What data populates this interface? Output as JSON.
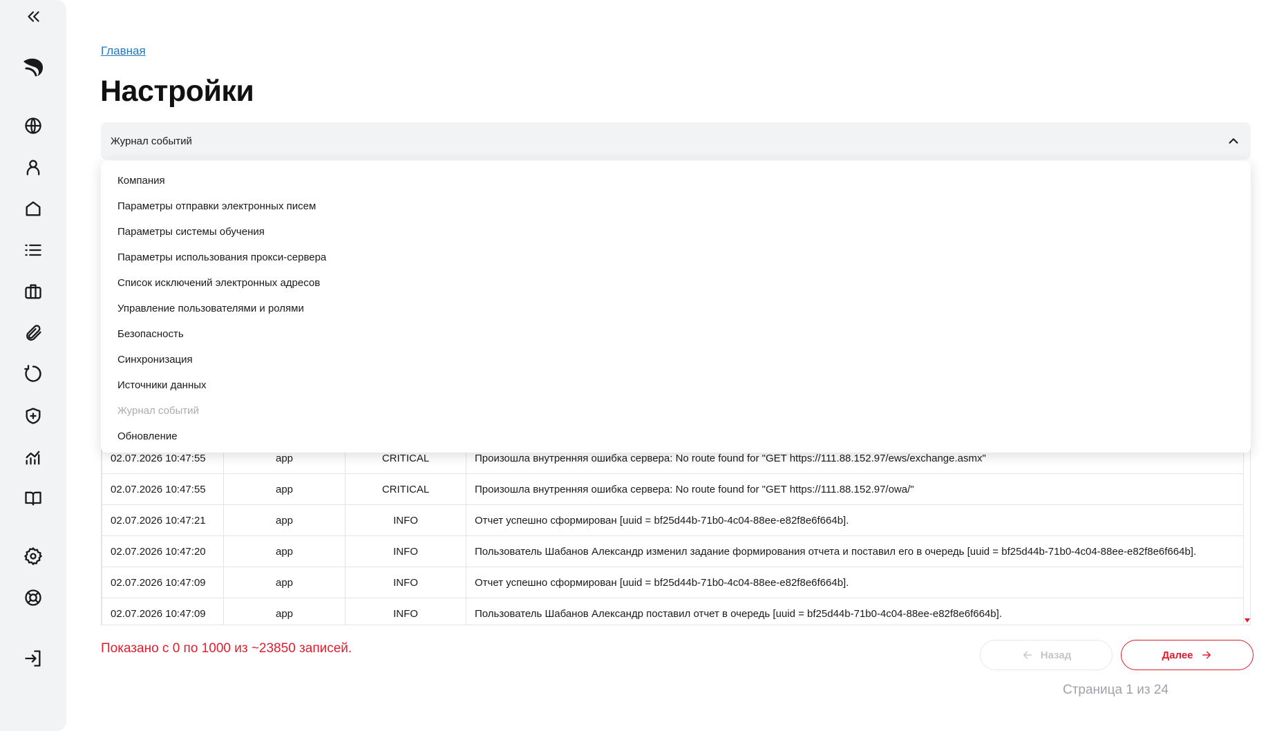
{
  "breadcrumb": "Главная",
  "title": "Настройки",
  "section_select": {
    "value": "Журнал событий",
    "options": [
      {
        "label": "Компания"
      },
      {
        "label": "Параметры отправки электронных писем"
      },
      {
        "label": "Параметры системы обучения"
      },
      {
        "label": "Параметры использования прокси-сервера"
      },
      {
        "label": "Список исключений электронных адресов"
      },
      {
        "label": "Управление пользователями и ролями"
      },
      {
        "label": "Безопасность"
      },
      {
        "label": "Синхронизация"
      },
      {
        "label": "Источники данных"
      },
      {
        "label": "Журнал событий",
        "disabled": true
      },
      {
        "label": "Обновление"
      }
    ]
  },
  "sidebar": {
    "items": [
      "collapse-icon",
      "logo-icon",
      "globe-icon",
      "user-icon",
      "home-icon",
      "list-icon",
      "briefcase-icon",
      "paperclip-icon",
      "refresh-icon",
      "shield-plus-icon",
      "analytics-icon",
      "book-icon",
      "gear-icon",
      "lifebuoy-icon",
      "logout-icon"
    ]
  },
  "log_rows": [
    {
      "date": "02.07.2026 10:47:55",
      "source": "app",
      "level": "CRITICAL",
      "message": "Произошла внутренняя ошибка сервера: No route found for \"GET https://111.88.152.97/ews/exchange.asmx\""
    },
    {
      "date": "02.07.2026 10:47:55",
      "source": "app",
      "level": "CRITICAL",
      "message": "Произошла внутренняя ошибка сервера: No route found for \"GET https://111.88.152.97/owa/\""
    },
    {
      "date": "02.07.2026 10:47:21",
      "source": "app",
      "level": "INFO",
      "message": "Отчет успешно сформирован [uuid = bf25d44b-71b0-4c04-88ee-e82f8e6f664b]."
    },
    {
      "date": "02.07.2026 10:47:20",
      "source": "app",
      "level": "INFO",
      "message": "Пользователь Шабанов Александр изменил задание формирования отчета и поставил его в очередь [uuid = bf25d44b-71b0-4c04-88ee-e82f8e6f664b]."
    },
    {
      "date": "02.07.2026 10:47:09",
      "source": "app",
      "level": "INFO",
      "message": "Отчет успешно сформирован [uuid = bf25d44b-71b0-4c04-88ee-e82f8e6f664b]."
    },
    {
      "date": "02.07.2026 10:47:09",
      "source": "app",
      "level": "INFO",
      "message": "Пользователь Шабанов Александр поставил отчет в очередь [uuid = bf25d44b-71b0-4c04-88ee-e82f8e6f664b]."
    }
  ],
  "summary": "Показано с 0 по 1000 из ~23850 записей.",
  "pagination": {
    "prev_label": "Назад",
    "next_label": "Далее",
    "page_info": "Страница 1 из 24"
  },
  "colors": {
    "accent": "#e31b2c",
    "link": "#1f78c1",
    "sidebar_bg": "#f2f3f5"
  }
}
